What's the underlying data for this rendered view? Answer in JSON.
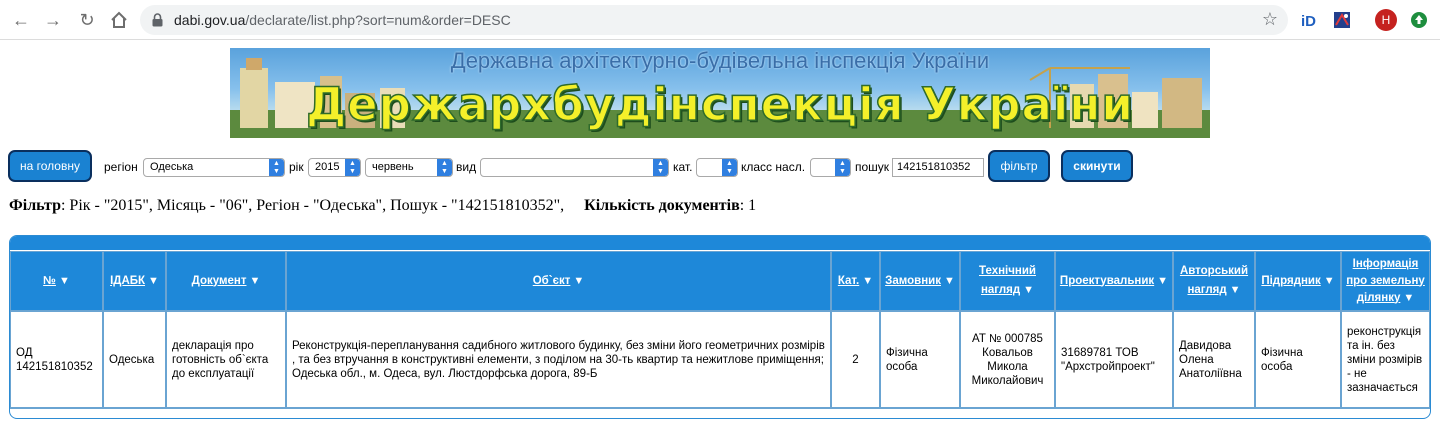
{
  "browser": {
    "url_host": "dabi.gov.ua",
    "url_path": "/declarate/list.php?sort=num&order=DESC",
    "profile_initial": "H"
  },
  "banner": {
    "subtitle": "Державна архітектурно-будівельна інспекція України",
    "title": "Держархбудінспекція України"
  },
  "toolbar": {
    "home_label": "на головну",
    "region_label": "регіон",
    "region_value": "Одеська",
    "year_label": "рік",
    "year_value": "2015",
    "month_value": "червень",
    "type_label": "вид",
    "type_value": "",
    "cat_label": "кат.",
    "cat_value": "",
    "class_label": "класс насл.",
    "class_value": "",
    "search_label": "пошук",
    "search_value": "142151810352",
    "filter_label": "фільтр",
    "reset_label": "скинути"
  },
  "summary": {
    "filter_label": "Фільтр",
    "filter_text": ": Рік - \"2015\", Місяць - \"06\", Регіон - \"Одеська\", Пошук - \"142151810352\",",
    "count_label": "Кількість документів",
    "count_value": ": 1"
  },
  "table": {
    "headers": {
      "num": "№",
      "idabk": "ІДАБК",
      "doc": "Документ",
      "object": "Об`єкт",
      "cat": "Кат.",
      "customer": "Замовник",
      "tech_l1": "Технічний",
      "tech_l2": "нагляд",
      "designer": "Проектувальник",
      "author_l1": "Авторський",
      "author_l2": "нагляд",
      "contractor": "Підрядник",
      "land_l1": "Інформація",
      "land_l2": "про земельну",
      "land_l3": "ділянку"
    },
    "row": {
      "num": "ОД 142151810352",
      "idabk": "Одеська",
      "doc": "декларація про готовність об`єкта до експлуатації",
      "object": "Реконструкція-перепланування садибного житлового будинку, без зміни його геометричних розмірів , та без втручання в конструктивні елементи, з поділом на 30-ть квартир та нежитлове приміщення; Одеська обл., м. Одеса, вул. Люстдорфська дорога, 89-Б",
      "cat": "2",
      "customer": "Фізична особа",
      "tech": "АТ № 000785 Ковальов Микола Миколайович",
      "designer": "31689781 ТОВ \"Архстройпроект\"",
      "author": "Давидова Олена Анатоліївна",
      "contractor": "Фізична особа",
      "land": "реконструкція та ін. без зміни розмірів - не зазначається"
    }
  }
}
